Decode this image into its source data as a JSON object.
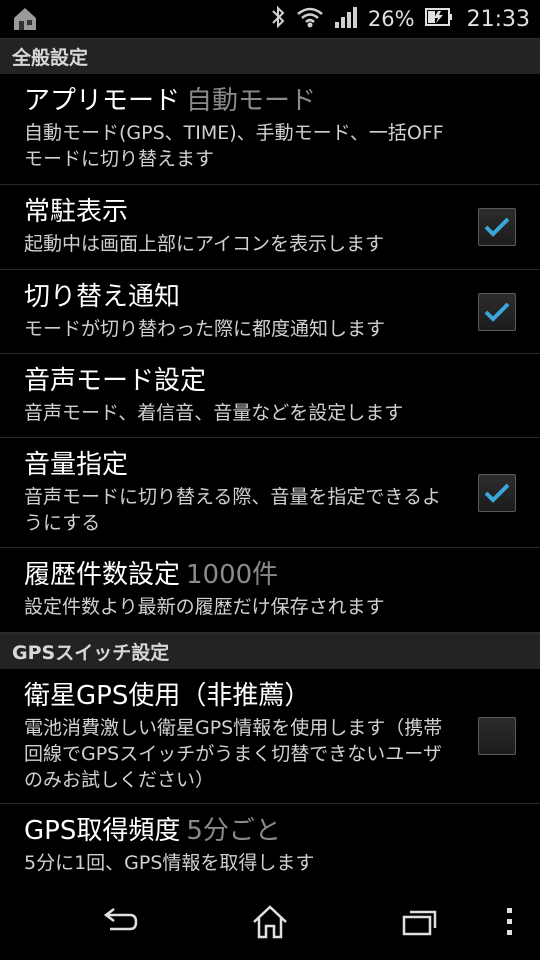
{
  "status_bar": {
    "battery_percent": "26%",
    "time": "21:33",
    "icons": [
      "app-notification-icon",
      "bluetooth-icon",
      "wifi-icon",
      "signal-icon",
      "battery-charging-icon"
    ]
  },
  "sections": {
    "general": {
      "header": "全般設定",
      "app_mode": {
        "title": "アプリモード",
        "value": "自動モード",
        "summary": "自動モード(GPS、TIME)、手動モード、一括OFFモードに切り替えます"
      },
      "resident": {
        "title": "常駐表示",
        "summary": "起動中は画面上部にアイコンを表示します",
        "checked": true
      },
      "switch_notify": {
        "title": "切り替え通知",
        "summary": "モードが切り替わった際に都度通知します",
        "checked": true
      },
      "sound_mode": {
        "title": "音声モード設定",
        "summary": "音声モード、着信音、音量などを設定します"
      },
      "volume": {
        "title": "音量指定",
        "summary": "音声モードに切り替える際、音量を指定できるようにする",
        "checked": true
      },
      "history": {
        "title": "履歴件数設定",
        "value": "1000件",
        "summary": "設定件数より最新の履歴だけ保存されます"
      }
    },
    "gps": {
      "header": "GPSスイッチ設定",
      "satellite": {
        "title": "衛星GPS使用（非推薦）",
        "summary": "電池消費激しい衛星GPS情報を使用します（携帯回線でGPSスイッチがうまく切替できないユーザのみお試しください）",
        "checked": false
      },
      "frequency": {
        "title": "GPS取得頻度",
        "value": "5分ごと",
        "summary": "5分に1回、GPS情報を取得します"
      }
    }
  },
  "colors": {
    "accent": "#3aa6dc",
    "background": "#000000",
    "section_header_bg": "#232323",
    "secondary_text": "#8a8a8a"
  },
  "nav_bar": {
    "icons": [
      "back-icon",
      "home-icon",
      "recents-icon",
      "overflow-menu-icon"
    ]
  }
}
